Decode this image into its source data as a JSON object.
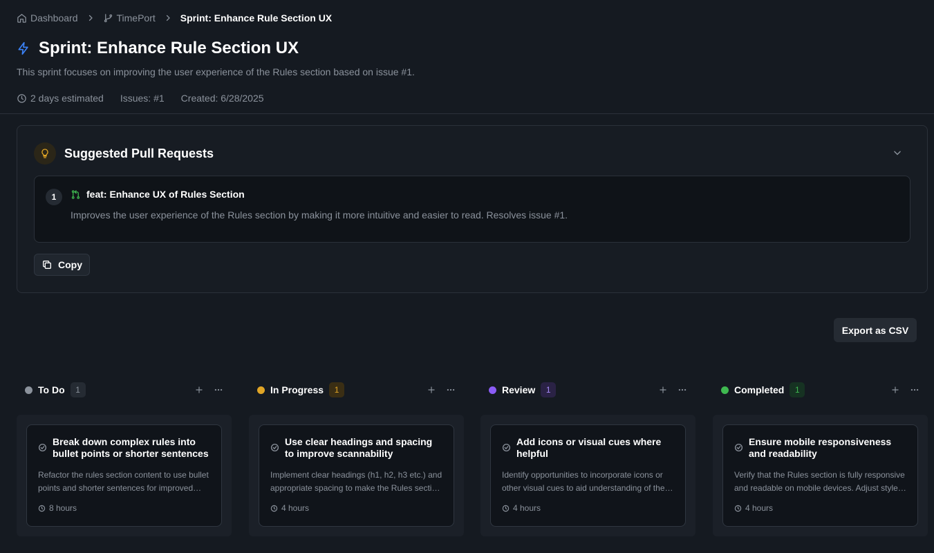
{
  "breadcrumb": {
    "items": [
      {
        "label": "Dashboard",
        "icon": "home-icon"
      },
      {
        "label": "TimePort",
        "icon": "git-branch-icon"
      },
      {
        "label": "Sprint: Enhance Rule Section UX"
      }
    ]
  },
  "sprint": {
    "title": "Sprint: Enhance Rule Section UX",
    "description": "This sprint focuses on improving the user experience of the Rules section based on issue #1.",
    "estimate": "2 days estimated",
    "issues": "Issues: #1",
    "created": "Created: 6/28/2025"
  },
  "pull_requests": {
    "title": "Suggested Pull Requests",
    "items": [
      {
        "number": "1",
        "title": "feat: Enhance UX of Rules Section",
        "description": "Improves the user experience of the Rules section by making it more intuitive and easier to read. Resolves issue #1."
      }
    ],
    "copy_label": "Copy"
  },
  "export_label": "Export as CSV",
  "colors": {
    "accent": "#3b82f6",
    "todo": "#8b929c",
    "in_progress": "#e0a526",
    "review": "#8b5cf6",
    "completed": "#3fb950"
  },
  "columns": [
    {
      "name": "To Do",
      "count": "1",
      "card": {
        "title": "Break down complex rules into bullet points or shorter sentences",
        "description": "Refactor the rules section content to use bullet points and shorter sentences for improved readability.",
        "estimate": "8 hours"
      }
    },
    {
      "name": "In Progress",
      "count": "1",
      "card": {
        "title": "Use clear headings and spacing to improve scannability",
        "description": "Implement clear headings (h1, h2, h3 etc.) and appropriate spacing to make the Rules section easier to scan.",
        "estimate": "4 hours"
      }
    },
    {
      "name": "Review",
      "count": "1",
      "card": {
        "title": "Add icons or visual cues where helpful",
        "description": "Identify opportunities to incorporate icons or other visual cues to aid understanding of the rules.",
        "estimate": "4 hours"
      }
    },
    {
      "name": "Completed",
      "count": "1",
      "card": {
        "title": "Ensure mobile responsiveness and readability",
        "description": "Verify that the Rules section is fully responsive and readable on mobile devices. Adjust styles as needed.",
        "estimate": "4 hours"
      }
    }
  ]
}
